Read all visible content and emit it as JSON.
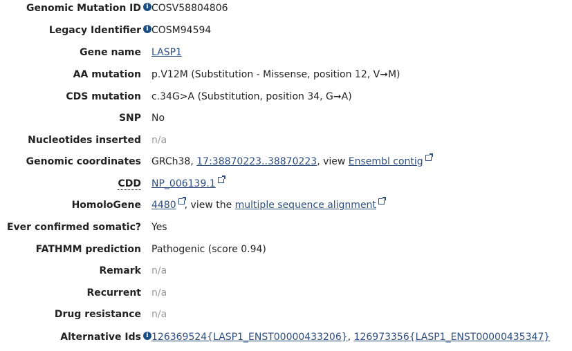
{
  "rows": [
    {
      "label": "Genomic Mutation ID",
      "value": "COSV58804806"
    },
    {
      "label": "Legacy Identifier",
      "value": "COSM94594"
    },
    {
      "label": "Gene name",
      "link": "LASP1"
    },
    {
      "label": "AA mutation",
      "value": "p.V12M (Substitution - Missense, position 12, V➞M)"
    },
    {
      "label": "CDS mutation",
      "value": "c.34G>A (Substitution, position 34, G➞A)"
    },
    {
      "label": "SNP",
      "value": "No"
    },
    {
      "label": "Nucleotides inserted",
      "value": "n/a"
    },
    {
      "label": "Genomic coordinates",
      "prefix": "GRCh38, ",
      "link": "17:38870223..38870223",
      "mid": ", view ",
      "link2": "Ensembl contig"
    },
    {
      "label": "CDD",
      "link": "NP_006139.1"
    },
    {
      "label": "HomoloGene",
      "link": "4480",
      "mid": ", view the ",
      "link2": "multiple sequence alignment"
    },
    {
      "label": "Ever confirmed somatic?",
      "value": "Yes"
    },
    {
      "label": "FATHMM prediction",
      "value": "Pathogenic (score 0.94)"
    },
    {
      "label": "Remark",
      "value": "n/a"
    },
    {
      "label": "Recurrent",
      "value": "n/a"
    },
    {
      "label": "Drug resistance",
      "value": "n/a"
    },
    {
      "label": "Alternative Ids",
      "link": "126369524{LASP1_ENST00000433206}",
      "mid": ", ",
      "link2": "126973356{LASP1_ENST00000435347}"
    }
  ],
  "icons": {
    "info": "i",
    "info_color": "#1a4f86",
    "link_color": "#2d4e7f",
    "muted_color": "#999999"
  }
}
